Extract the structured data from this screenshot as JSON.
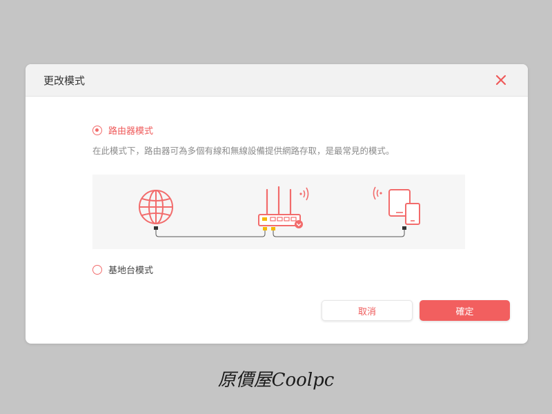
{
  "dialog": {
    "title": "更改模式",
    "close_icon": "close-icon"
  },
  "modes": {
    "router": {
      "label": "路由器模式",
      "selected": true,
      "description": "在此模式下，路由器可為多個有線和無線設備提供網路存取，是最常見的模式。"
    },
    "access_point": {
      "label": "基地台模式",
      "selected": false
    }
  },
  "diagram": {
    "icons": [
      "globe-icon",
      "router-icon",
      "wifi-signal-icon",
      "tablet-icon",
      "phone-icon"
    ]
  },
  "buttons": {
    "cancel": "取消",
    "confirm": "確定"
  },
  "watermark": {
    "text": "原價屋Coolpc"
  },
  "colors": {
    "accent": "#f25f5f",
    "background": "#c5c5c5",
    "header": "#f2f2f2",
    "router_port": "#f5b800"
  }
}
